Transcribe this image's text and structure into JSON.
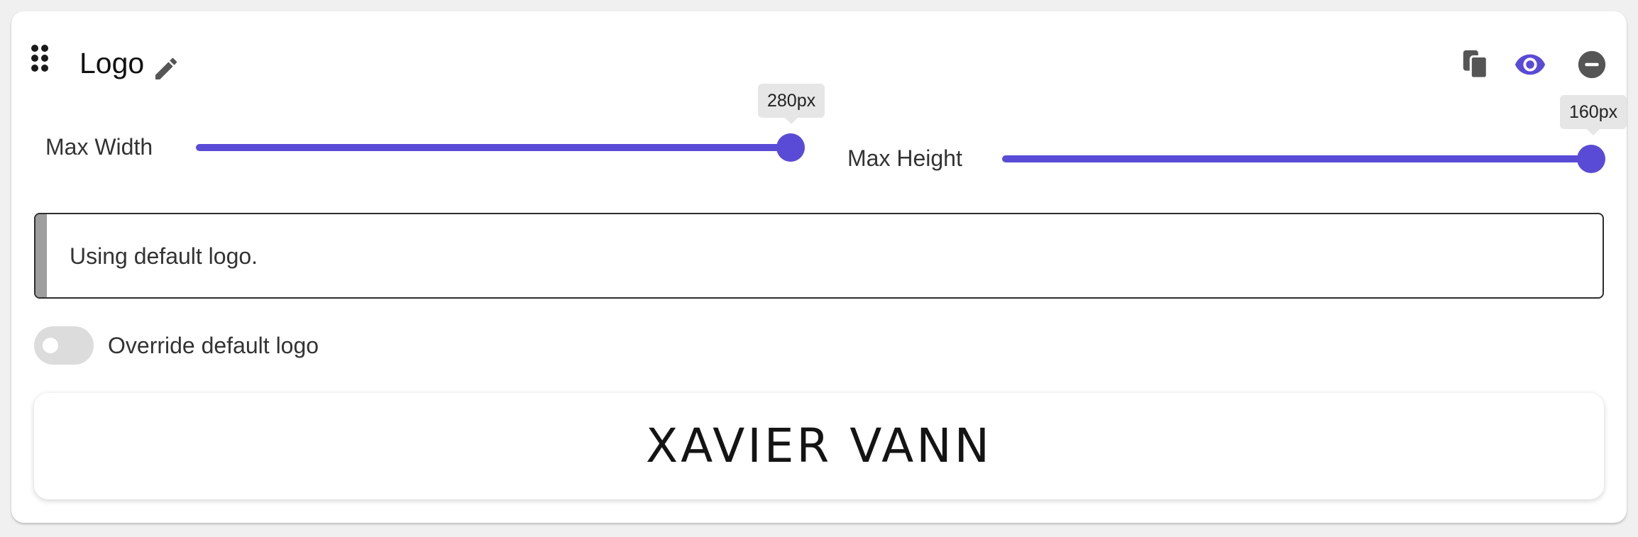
{
  "panel": {
    "title": "Logo"
  },
  "header_icons": {
    "drag": "drag-handle-icon",
    "edit": "pencil-icon",
    "copy": "copy-icon",
    "visibility": "eye-icon",
    "remove": "remove-circle-icon"
  },
  "sliders": {
    "max_width": {
      "label": "Max Width",
      "value_label": "280px",
      "level": 1.0
    },
    "max_height": {
      "label": "Max Height",
      "value_label": "160px",
      "level": 1.0
    }
  },
  "notice": {
    "text": "Using default logo."
  },
  "override_toggle": {
    "label": "Override default logo",
    "checked": false
  },
  "preview": {
    "logo_text": "XAVIER VANN"
  },
  "colors": {
    "accent": "#5a4bd6",
    "icon_gray": "#555555",
    "notice_bar": "#9e9e9e"
  }
}
